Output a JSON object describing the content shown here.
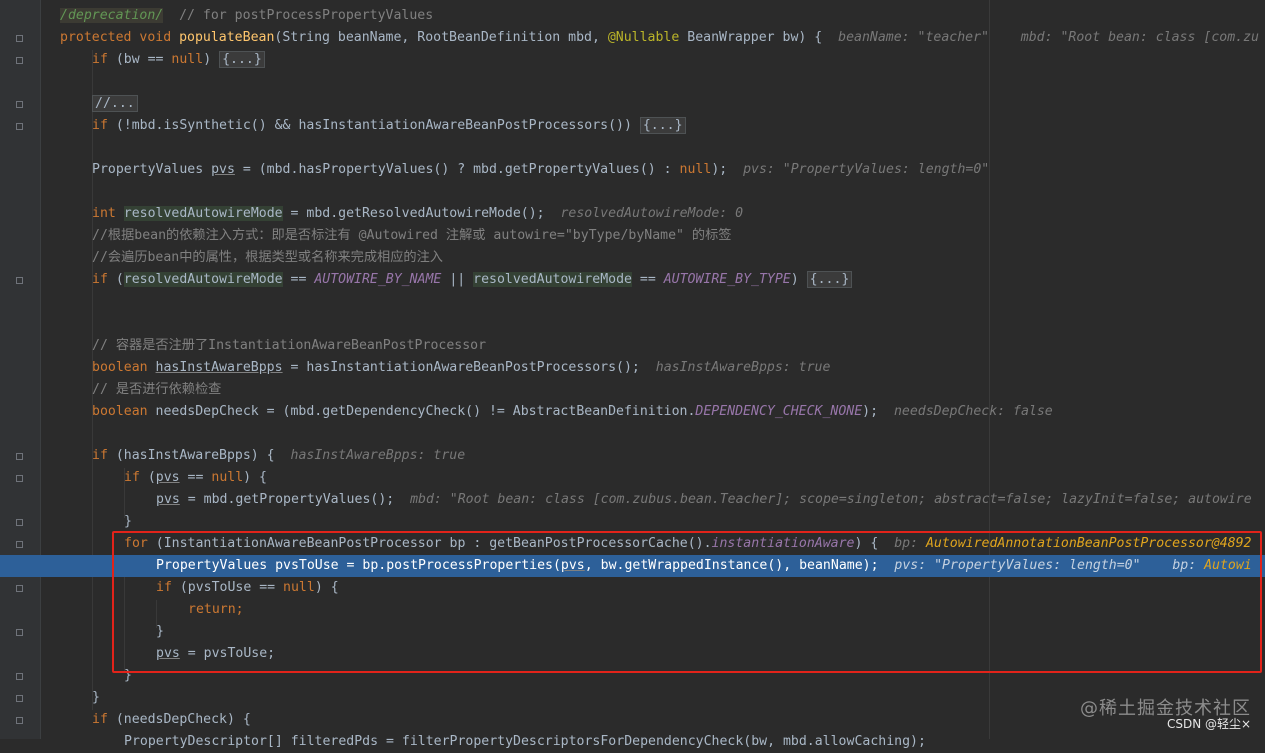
{
  "editor": {
    "language": "java",
    "lines": {
      "l0_dep": "/deprecation/",
      "l0_comment": "// for postProcessPropertyValues",
      "l1_kw": "protected void",
      "l1_name": "populateBean",
      "l1_p1": "(String beanName, RootBeanDefinition mbd, ",
      "l1_ann": "@Nullable",
      "l1_p2": " BeanWrapper bw) {",
      "l1_hint1": "beanName: \"teacher\"",
      "l1_hint2": "mbd: \"Root bean: class [com.zu",
      "l2_if": "if",
      "l2_rest": " (bw == ",
      "l2_null": "null",
      "l2_close": ") ",
      "fold_dots": "{...}",
      "l4_cm": "//...",
      "l5_if": "if",
      "l5_rest": " (!mbd.isSynthetic() && hasInstantiationAwareBeanPostProcessors()) ",
      "l7_a": "PropertyValues ",
      "l7_pvs": "pvs",
      "l7_b": " = (mbd.hasPropertyValues() ? mbd.getPropertyValues() : ",
      "l7_c": ");",
      "l7_hint": "pvs: \"PropertyValues: length=0\"",
      "l9_int": "int",
      "l9_var": "resolvedAutowireMode",
      "l9_rest": " = mbd.getResolvedAutowireMode();",
      "l9_hint": "resolvedAutowireMode: 0",
      "l10_cm": "//根据bean的依赖注入方式：即是否标注有 @Autowired 注解或 autowire=\"byType/byName\" 的标签",
      "l11_cm": "//会遍历bean中的属性，根据类型或名称来完成相应的注入",
      "l12_if": "if",
      "l12_a": " (",
      "l12_var": "resolvedAutowireMode",
      "l12_b": " == ",
      "l12_c1": "AUTOWIRE_BY_NAME",
      "l12_or": " || ",
      "l12_var2": "resolvedAutowireMode",
      "l12_c2": "AUTOWIRE_BY_TYPE",
      "l12_close": ") ",
      "l15_cm": "// 容器是否注册了InstantiationAwareBeanPostProcessor",
      "l16_kw": "boolean",
      "l16_var": "hasInstAwareBpps",
      "l16_rest": " = hasInstantiationAwareBeanPostProcessors();",
      "l16_hint": "hasInstAwareBpps: true",
      "l17_cm": "// 是否进行依赖检查",
      "l18_kw": "boolean",
      "l18_rest": " needsDepCheck = (mbd.getDependencyCheck() != AbstractBeanDefinition.",
      "l18_const": "DEPENDENCY_CHECK_NONE",
      "l18_close": ");",
      "l18_hint": "needsDepCheck: false",
      "l20_if": "if",
      "l20_rest": " (hasInstAwareBpps) {",
      "l20_hint": "hasInstAwareBpps: true",
      "l21_if": "if",
      "l21_a": " (",
      "l21_pvs": "pvs",
      "l21_b": " == ",
      "l21_null": "null",
      "l21_c": ") {",
      "l22_pvs": "pvs",
      "l22_rest": " = mbd.getPropertyValues();",
      "l22_hint": "mbd: \"Root bean: class [com.zubus.bean.Teacher]; scope=singleton; abstract=false; lazyInit=false; autowire",
      "brace": "}",
      "l24_for": "for",
      "l24_rest": " (InstantiationAwareBeanPostProcessor bp : getBeanPostProcessorCache().",
      "l24_field": "instantiationAware",
      "l24_close": ") {",
      "l24_hint_a": "bp: ",
      "l24_hint_b": "AutowiredAnnotationBeanPostProcessor@4892",
      "l25_a": "PropertyValues pvsToUse = bp.postProcessProperties(",
      "l25_pvs": "pvs",
      "l25_b": ", bw.getWrappedInstance(), beanName);",
      "l25_hint1": "pvs: \"PropertyValues: length=0\"",
      "l25_hint2_a": "bp: ",
      "l25_hint2_b": "Autowi",
      "l26_if": "if",
      "l26_rest": " (pvsToUse == ",
      "l26_null": "null",
      "l26_close": ") {",
      "l27_ret": "return",
      "l27_semi": ";",
      "l29_pvs": "pvs",
      "l29_rest": " = pvsToUse;",
      "l32_if": "if",
      "l32_rest": " (needsDepCheck) {",
      "l33_partial": "PropertyDescriptor[] filteredPds = filterPropertyDescriptorsForDependencyCheck(bw, mbd.allowCaching);"
    }
  },
  "watermark": {
    "site": "@稀土掘金技术社区",
    "author": "CSDN @轻尘×"
  },
  "colors": {
    "background": "#2b2b2b",
    "keyword": "#cc7832",
    "selection": "#2d6099",
    "highlight_box": "#e2231a"
  }
}
